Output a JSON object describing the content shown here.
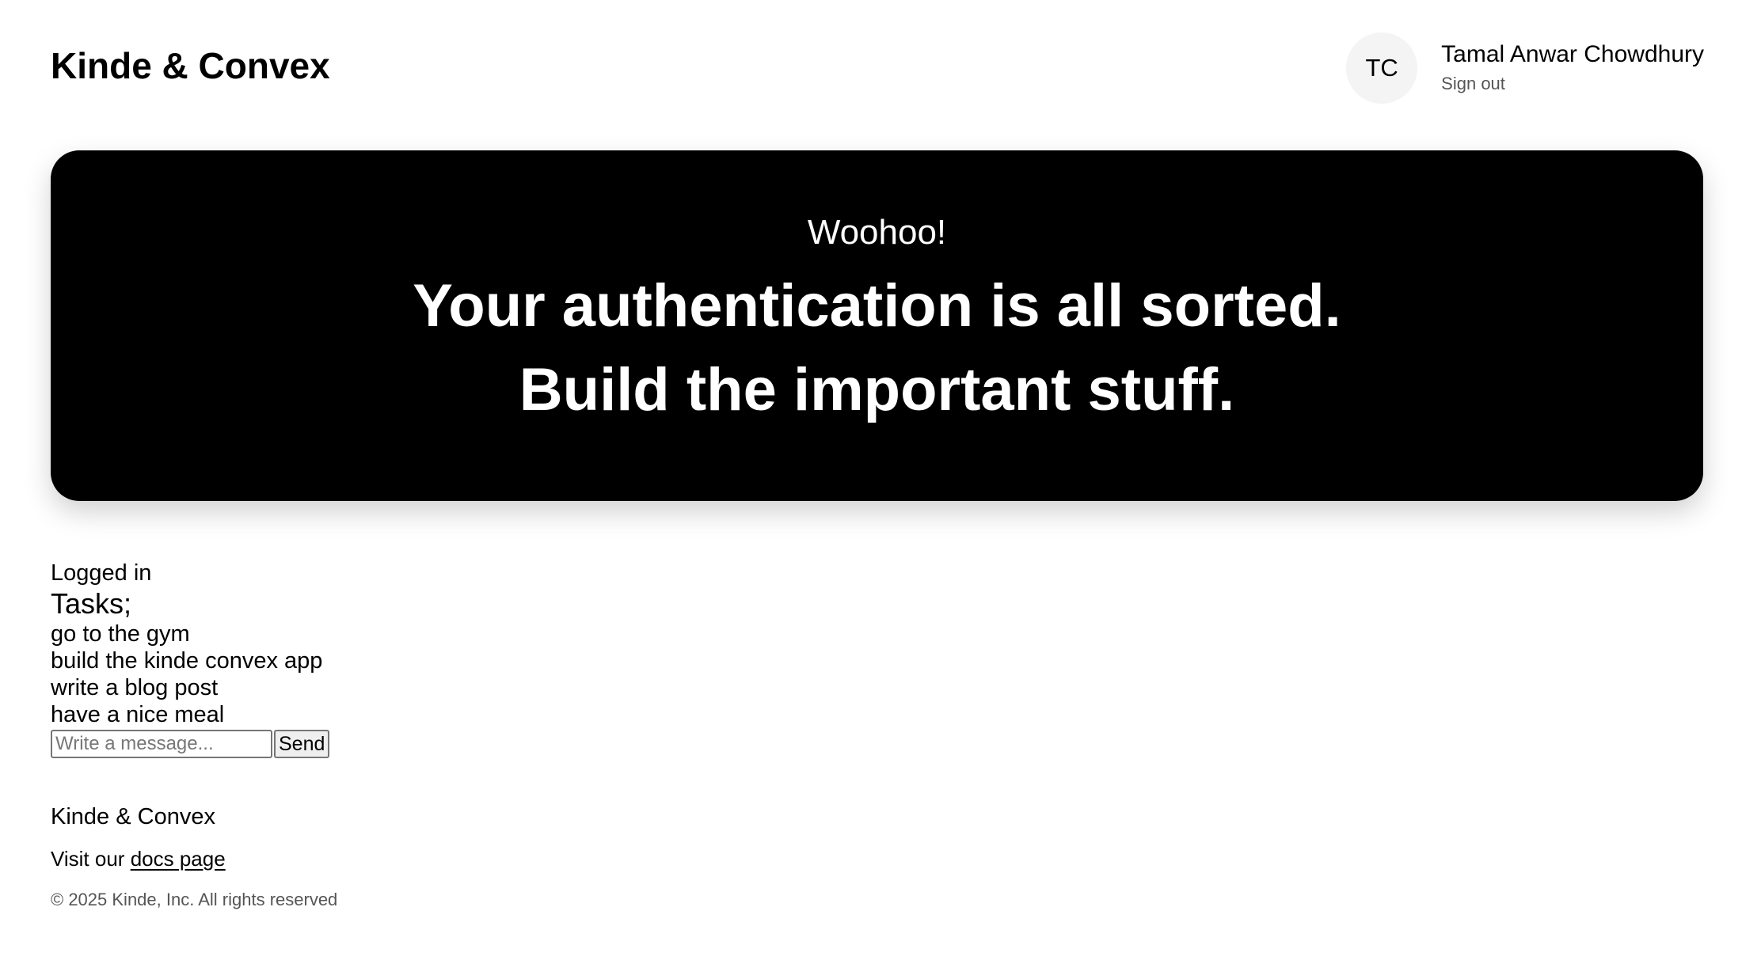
{
  "header": {
    "brand": "Kinde & Convex",
    "user": {
      "initials": "TC",
      "name": "Tamal Anwar Chowdhury",
      "sign_out_label": "Sign out"
    }
  },
  "hero": {
    "kicker": "Woohoo!",
    "line_1": "Your authentication is all sorted.",
    "line_2": "Build the important stuff."
  },
  "content": {
    "status": "Logged in",
    "tasks_heading": "Tasks;",
    "tasks": [
      "go to the gym",
      "build the kinde convex app",
      "write a blog post",
      "have a nice meal"
    ],
    "message_form": {
      "input_value": "",
      "input_placeholder": "Write a message...",
      "send_label": "Send"
    }
  },
  "footer": {
    "brand": "Kinde & Convex",
    "visit_prefix": "Visit our ",
    "docs_link_label": "docs page",
    "copyright": "© 2025 Kinde, Inc. All rights reserved"
  },
  "colors": {
    "background": "#ffffff",
    "hero_background": "#000000",
    "hero_text": "#ffffff",
    "avatar_background": "#f4f4f4",
    "muted_text": "#555555"
  }
}
